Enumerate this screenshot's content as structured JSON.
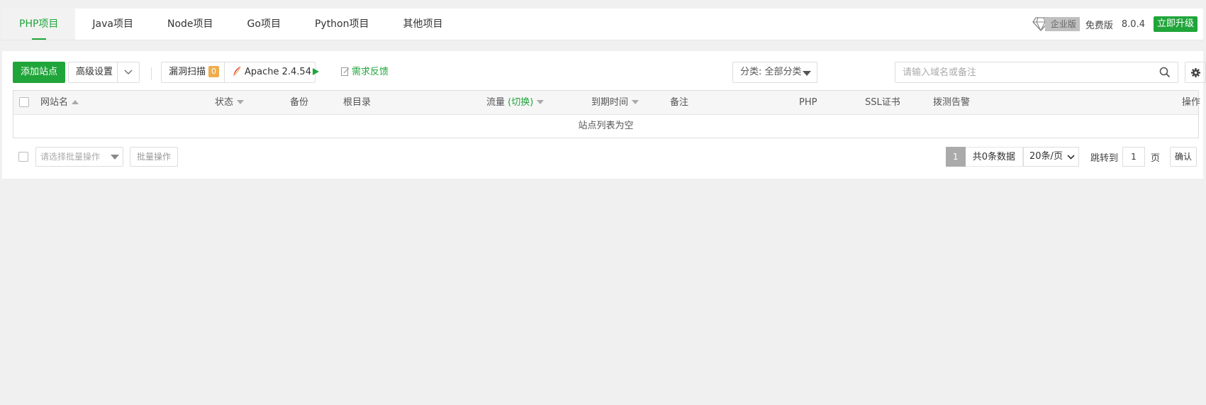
{
  "tabs": [
    {
      "label": "PHP项目",
      "active": true
    },
    {
      "label": "Java项目"
    },
    {
      "label": "Node项目"
    },
    {
      "label": "Go项目"
    },
    {
      "label": "Python项目"
    },
    {
      "label": "其他项目"
    }
  ],
  "header": {
    "enterprise_label": "企业版",
    "free_label": "免费版",
    "version": "8.0.4",
    "upgrade_label": "立即升级",
    "diamond_icon": "diamond-icon"
  },
  "toolbar": {
    "add_site": "添加站点",
    "advanced_settings": "高级设置",
    "vuln_scan": "漏洞扫描",
    "vuln_count": "0",
    "apache": "Apache 2.4.54",
    "feedback": "需求反馈",
    "category": "分类: 全部分类",
    "search_placeholder": "请输入域名或备注"
  },
  "table": {
    "columns": {
      "site_name": "网站名",
      "status": "状态",
      "backup": "备份",
      "root_dir": "根目录",
      "traffic": "流量",
      "traffic_switch": "(切换)",
      "expire": "到期时间",
      "remark": "备注",
      "php": "PHP",
      "ssl": "SSL证书",
      "monitor": "拨测告警",
      "actions": "操作"
    },
    "empty_text": "站点列表为空"
  },
  "footer": {
    "batch_placeholder": "请选择批量操作",
    "batch_button": "批量操作",
    "current_page": "1",
    "total": "共0条数据",
    "per_page": "20条/页",
    "jump_to": "跳转到",
    "jump_value": "1",
    "page_unit": "页",
    "confirm": "确认"
  },
  "colors": {
    "accent": "#20a53a",
    "badge": "#f0ad4e"
  }
}
